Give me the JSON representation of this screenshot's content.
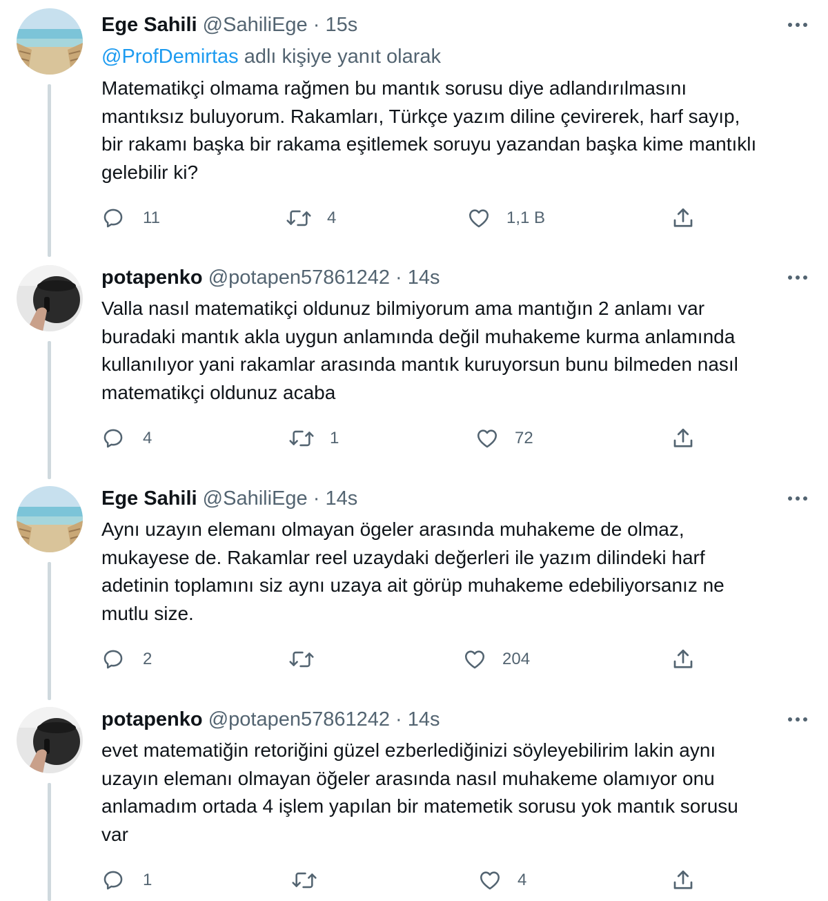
{
  "thread": [
    {
      "author_name": "Ege Sahili",
      "handle": "@SahiliEge",
      "separator": "·",
      "time": "15s",
      "replying_mention": "@ProfDemirtas",
      "replying_suffix": "adlı kişiye yanıt olarak",
      "text": "Matematikçi olmama rağmen bu mantık sorusu diye adlandırılmasını mantıksız buluyorum. Rakamları, Türkçe yazım diline çevirerek, harf sayıp, bir rakamı başka bir rakama eşitlemek soruyu yazandan başka kime mantıklı gelebilir ki?",
      "lines": [
        "Matematikçi olmama rağmen bu mantık sorusu diye adlandırılmasını",
        "mantıksız buluyorum. Rakamları, Türkçe yazım diline çevirerek, harf sayıp,",
        "bir rakamı başka bir rakama eşitlemek soruyu yazandan başka kime mantıklı",
        "gelebilir ki?"
      ],
      "replies": "11",
      "retweets": "4",
      "likes": "1,1 B",
      "avatar": "beach-photo"
    },
    {
      "author_name": "potapenko",
      "handle": "@potapen57861242",
      "separator": "·",
      "time": "14s",
      "lines": [
        "Valla nasıl matematikçi oldunuz bilmiyorum ama mantığın 2 anlamı var",
        "buradaki mantık akla uygun anlamında değil muhakeme kurma anlamında",
        "kullanılıyor yani rakamlar arasında mantık kuruyorsun bunu bilmeden nasıl",
        "matematikçi oldunuz acaba"
      ],
      "replies": "4",
      "retweets": "1",
      "likes": "72",
      "avatar": "dark-object-photo"
    },
    {
      "author_name": "Ege Sahili",
      "handle": "@SahiliEge",
      "separator": "·",
      "time": "14s",
      "lines": [
        "Aynı uzayın elemanı olmayan ögeler arasında muhakeme de olmaz,",
        "mukayese de. Rakamlar reel uzaydaki değerleri ile yazım dilindeki harf",
        "adetinin toplamını siz aynı uzaya ait görüp muhakeme edebiliyorsanız ne",
        "mutlu size."
      ],
      "replies": "2",
      "retweets": "",
      "likes": "204",
      "avatar": "beach-photo"
    },
    {
      "author_name": "potapenko",
      "handle": "@potapen57861242",
      "separator": "·",
      "time": "14s",
      "lines": [
        "evet matematiğin retoriğini güzel ezberlediğinizi söyleyebilirim lakin aynı",
        "uzayın elemanı olmayan öğeler arasında nasıl muhakeme olamıyor onu",
        "anlamadım ortada 4 işlem yapılan bir matemetik sorusu yok mantık sorusu",
        "var"
      ],
      "replies": "1",
      "retweets": "",
      "likes": "4",
      "avatar": "dark-object-photo"
    }
  ],
  "icons": {
    "reply": "speech-bubble-icon",
    "retweet": "retweet-icon",
    "like": "heart-icon",
    "share": "share-upload-icon",
    "more": "more-dots-icon"
  },
  "colors": {
    "text": "#0f1419",
    "muted": "#536471",
    "link": "#1d9bf0",
    "thread_line": "#cfd9de"
  }
}
